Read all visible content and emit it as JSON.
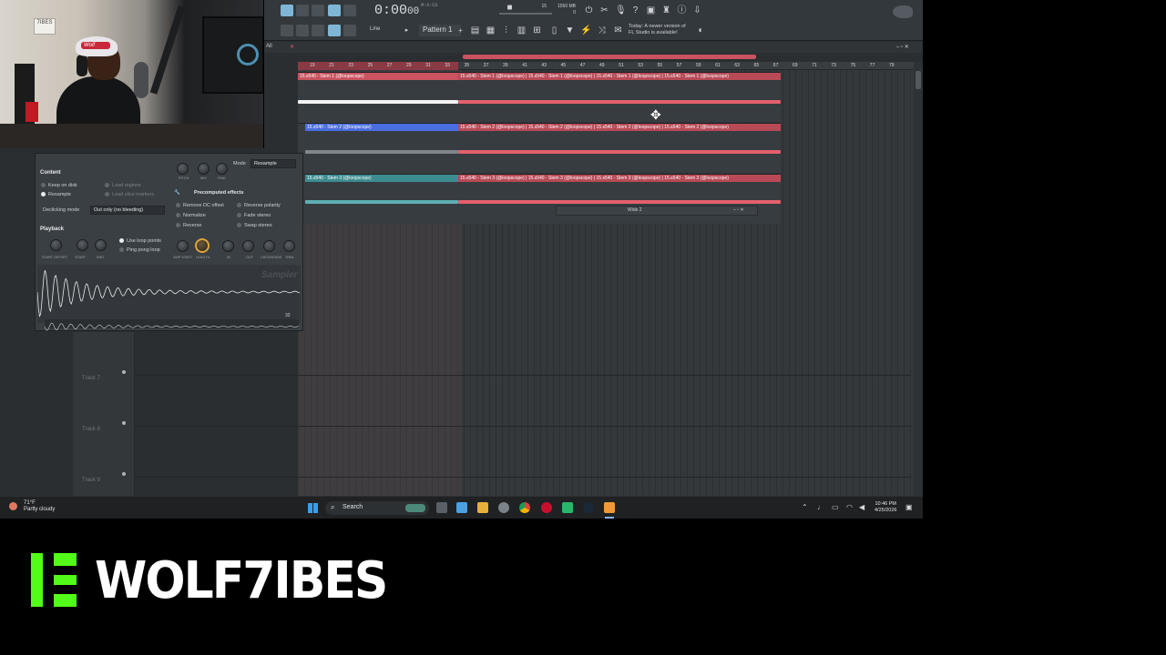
{
  "toolbar": {
    "time_value": "0:00",
    "time_sub": "00",
    "time_unit": "M:S:CS",
    "snap": "Line",
    "pattern": "Pattern 1",
    "cpu_mem": "1550 MB",
    "cpu_line2": "0",
    "cpu_poly": "15",
    "news_line1": "Today: A newer version of",
    "news_line2": "FL Studio is available!"
  },
  "webcam": {
    "cap_text": "Wolf",
    "poster_text": "7IBES"
  },
  "sampler": {
    "content_heading": "Content",
    "keep_on_disk": "Keep on disk",
    "resample": "Resample",
    "load_regions": "Load regions",
    "load_slice_markers": "Load slice markers",
    "declicking_label": "Declicking mode",
    "declicking_value": "Out only (no bleeding)",
    "playback_heading": "Playback",
    "use_loop_points": "Use loop points",
    "ping_pong_loop": "Ping pong loop",
    "mode_label": "Mode",
    "mode_value": "Resample",
    "precomputed_heading": "Precomputed effects",
    "remove_dc": "Remove DC offset",
    "normalize": "Normalize",
    "reverse": "Reverse",
    "reverse_polarity": "Reverse polarity",
    "fade_stereo": "Fade stereo",
    "swap_stereo": "Swap stereo",
    "knob_pitch": "PITCH",
    "knob_mix": "MIX",
    "knob_fine": "FINE",
    "knob_start_offset": "START OFFSET",
    "knob_start": "START",
    "knob_end": "END",
    "knob_smp_start": "SMP START",
    "knob_length": "LENGTH",
    "knob_in": "IN",
    "knob_out": "OUT",
    "knob_crossfade": "CROSSFADE",
    "knob_trim": "TRIM",
    "logo": "Sampler",
    "zoom_value": "32"
  },
  "playlist": {
    "title": "All",
    "ruler_numbers": [
      "19",
      "21",
      "23",
      "25",
      "27",
      "29",
      "31",
      "33",
      "35",
      "37",
      "39",
      "41",
      "43",
      "45",
      "47",
      "49",
      "51",
      "53",
      "55",
      "57",
      "59",
      "61",
      "63",
      "65",
      "67",
      "69",
      "71",
      "73",
      "75",
      "77",
      "79"
    ],
    "clip_label_1": "15.s540 - Stem 1 (@loopscope)",
    "clip_label_2": "15.s540 - Stem 2 (@loopscope)",
    "clip_label_3": "15.s540 - Stem 3 (@loopscope)",
    "tracks": [
      {
        "name": "Track 7"
      },
      {
        "name": "Track 8"
      },
      {
        "name": "Track 9"
      }
    ],
    "float_window_title": "Wide 2"
  },
  "taskbar": {
    "temp": "71°F",
    "condition": "Partly cloudy",
    "search_placeholder": "Search",
    "time": "10:46 PM",
    "date": "4/25/2026"
  },
  "brand": {
    "name": "WOLF7IBES"
  },
  "colors": {
    "accent_red": "#e2606c",
    "stem1": "#e06070",
    "stem2": "#4a6ee0",
    "stem3": "#5db0b5",
    "kick_green": "#53fc18"
  }
}
